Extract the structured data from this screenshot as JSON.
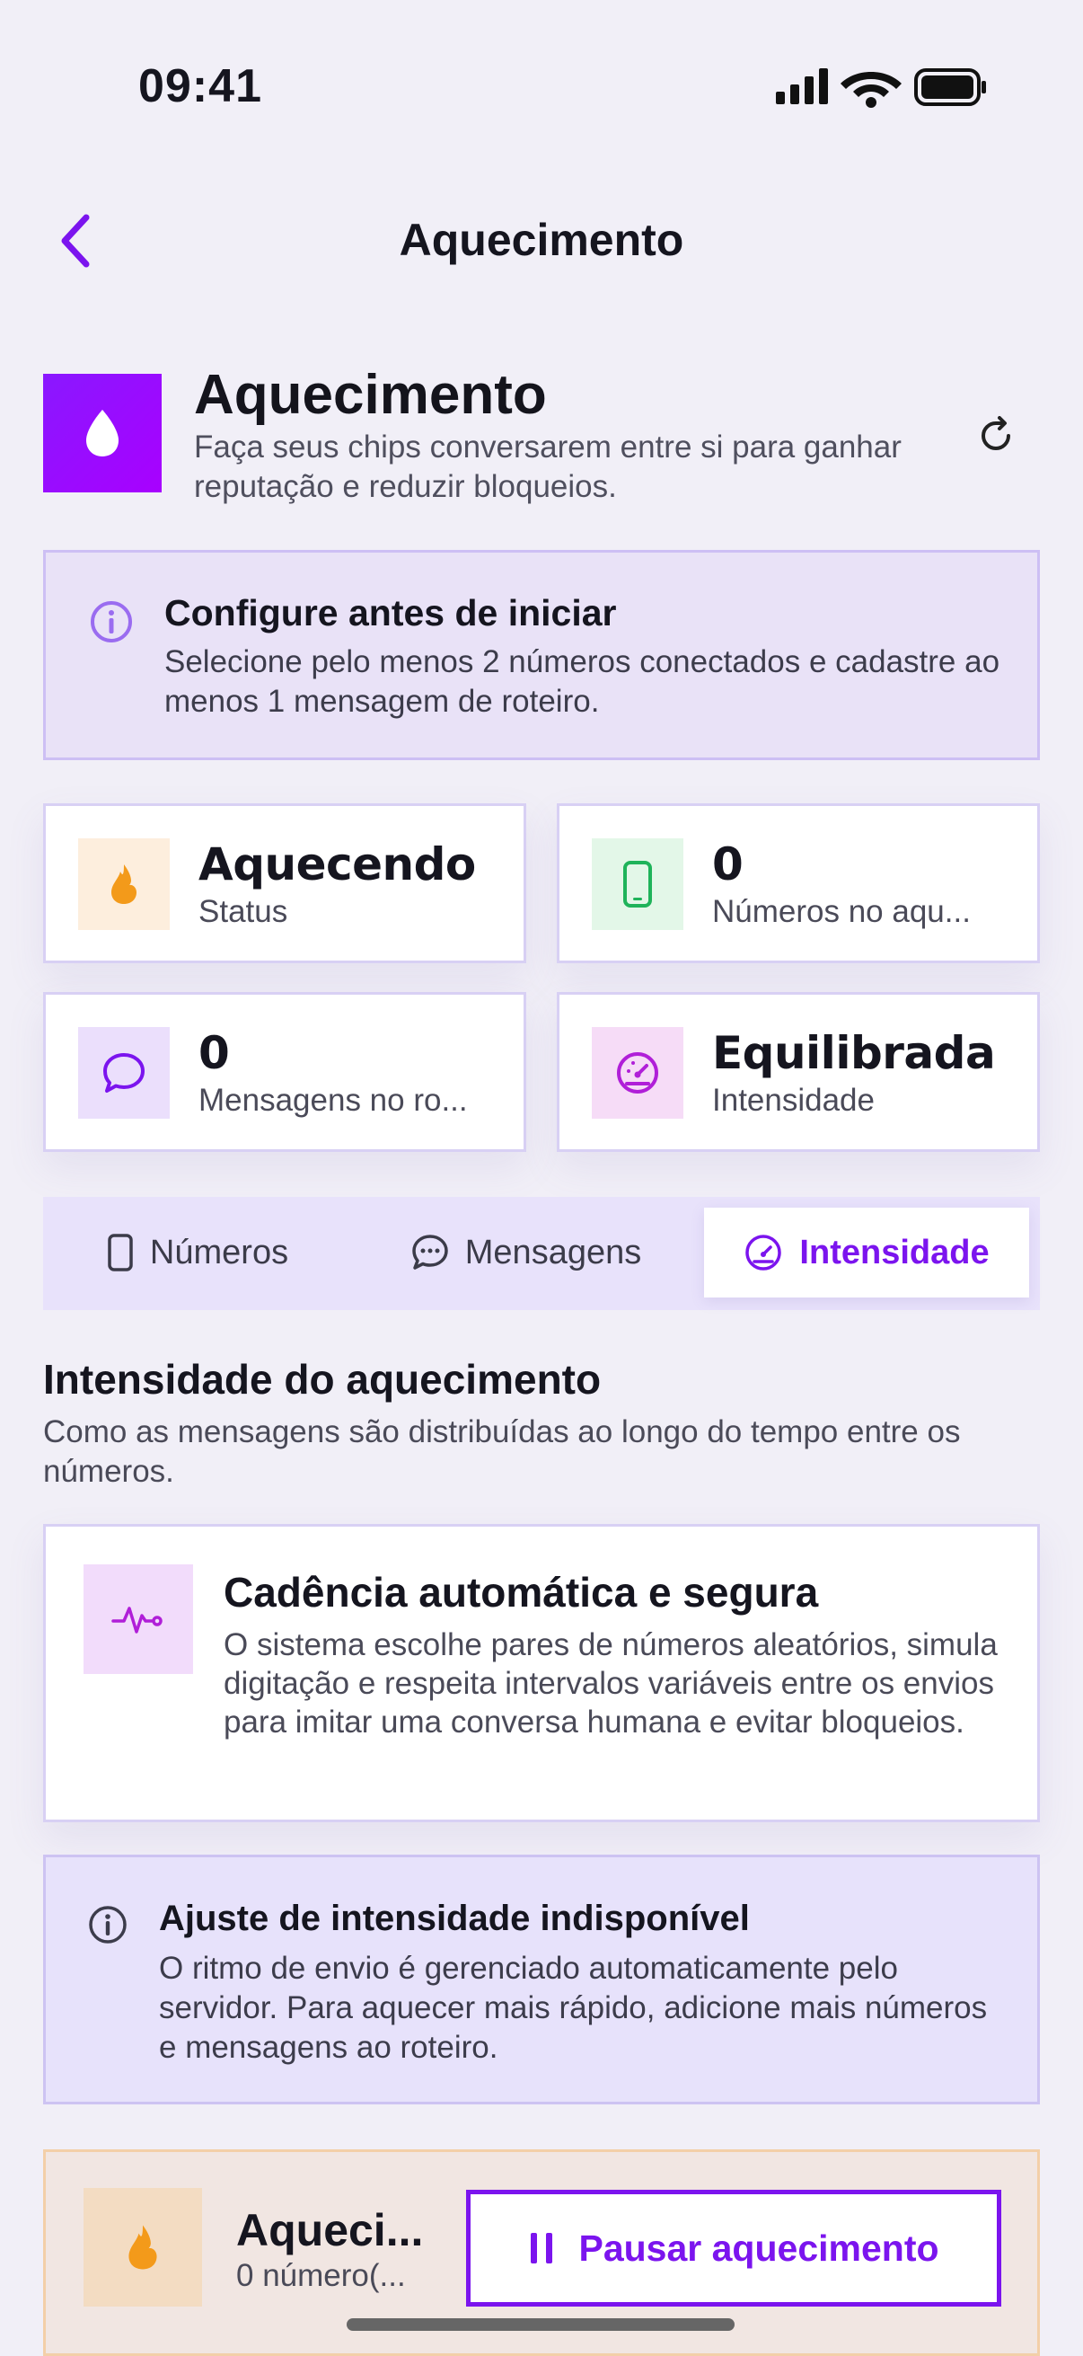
{
  "status_bar": {
    "time": "09:41"
  },
  "nav": {
    "title": "Aquecimento"
  },
  "header": {
    "title": "Aquecimento",
    "subtitle": "Faça seus chips conversarem entre si para ganhar reputação e reduzir bloqueios."
  },
  "notice": {
    "title": "Configure antes de iniciar",
    "text": "Selecione pelo menos 2 números conectados e cadastre ao menos 1 mensagem de roteiro."
  },
  "stats": [
    {
      "value": "Aquecendo",
      "label": "Status",
      "icon": "flame-icon"
    },
    {
      "value": "0",
      "label": "Números no aqu...",
      "icon": "phone-icon"
    },
    {
      "value": "0",
      "label": "Mensagens no ro...",
      "icon": "chat-icon"
    },
    {
      "value": "Equilibrada",
      "label": "Intensidade",
      "icon": "gauge-icon"
    }
  ],
  "tabs": [
    {
      "label": "Números",
      "active": false
    },
    {
      "label": "Mensagens",
      "active": false
    },
    {
      "label": "Intensidade",
      "active": true
    }
  ],
  "section": {
    "title": "Intensidade do aquecimento",
    "subtitle": "Como as mensagens são distribuídas ao longo do tempo entre os números."
  },
  "auto_card": {
    "title": "Cadência automática e segura",
    "text": "O sistema escolhe pares de números aleatórios, simula digitação e respeita intervalos variáveis entre os envios para imitar uma conversa humana e evitar bloqueios."
  },
  "notice2": {
    "title": "Ajuste de intensidade indisponível",
    "text": "O ritmo de envio é gerenciado automaticamente pelo servidor. Para aquecer mais rápido, adicione mais números e mensagens ao roteiro."
  },
  "bottom_bar": {
    "title": "Aqueci...",
    "subtitle": "0 número(...",
    "pause_label": "Pausar aquecimento"
  },
  "colors": {
    "accent": "#7b14ee",
    "background": "#f1eff7",
    "flame": "#f39a1a"
  }
}
